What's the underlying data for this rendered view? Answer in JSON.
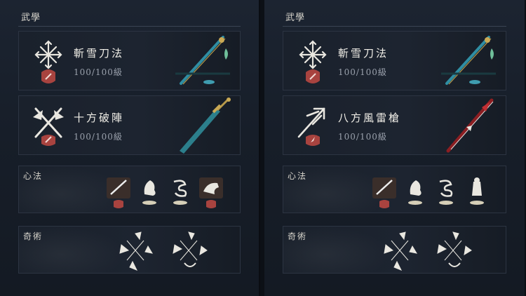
{
  "left": {
    "section_title": "武學",
    "weapons": [
      {
        "name": "斬雪刀法",
        "level": "100/100級",
        "icon": "snowflake-blade-icon",
        "weapon": "blade-weapon-art"
      },
      {
        "name": "十方破陣",
        "level": "100/100級",
        "icon": "crossed-swords-icon",
        "weapon": "sword-weapon-art"
      }
    ],
    "xinfa_title": "心法",
    "xinfa_icons": [
      "sword-stroke-icon",
      "horse-icon",
      "dragon-icon",
      "horse-rider-icon"
    ],
    "qishu_title": "奇術",
    "qishu_icons": [
      "martial-pose-cluster-icon",
      "martial-pose-cluster-icon"
    ]
  },
  "right": {
    "section_title": "武學",
    "weapons": [
      {
        "name": "斬雪刀法",
        "level": "100/100級",
        "icon": "snowflake-blade-icon",
        "weapon": "blade-weapon-art"
      },
      {
        "name": "八方風雷槍",
        "level": "100/100級",
        "icon": "spear-trident-icon",
        "weapon": "spear-weapon-art"
      }
    ],
    "xinfa_title": "心法",
    "xinfa_icons": [
      "sword-stroke-icon",
      "horse-icon",
      "dragon-icon",
      "figure-icon"
    ],
    "qishu_title": "奇術",
    "qishu_icons": [
      "martial-pose-cluster-icon",
      "martial-pose-cluster-icon"
    ]
  },
  "colors": {
    "accent_red": "#a8433f",
    "gold": "#b89a4a",
    "teal": "#3f9db0",
    "crimson": "#8c1e22"
  }
}
